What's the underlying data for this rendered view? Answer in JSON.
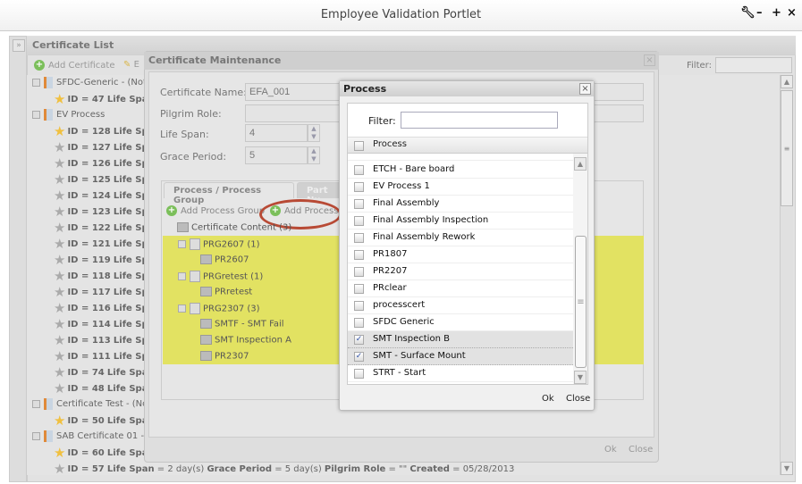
{
  "window": {
    "title": "Employee Validation Portlet",
    "controls": [
      "wrench-icon",
      "minimize-icon",
      "maximize-icon",
      "close-icon"
    ]
  },
  "cert_list": {
    "title": "Certificate List",
    "add_label": "Add Certificate",
    "edit_label": "E",
    "filter_label": "Filter:",
    "filter_value": "",
    "rows": [
      {
        "type": "cert",
        "text": "SFDC-Generic - (Not S"
      },
      {
        "type": "item",
        "star": "gold",
        "id": "ID = 47",
        "rest": "Life Span ="
      },
      {
        "type": "cert",
        "text": "EV Process"
      },
      {
        "type": "item",
        "star": "gold",
        "id": "ID = 128",
        "rest": "Life Span"
      },
      {
        "type": "item",
        "star": "grey",
        "id": "ID = 127",
        "rest": "Life Span"
      },
      {
        "type": "item",
        "star": "grey",
        "id": "ID = 126",
        "rest": "Life Span"
      },
      {
        "type": "item",
        "star": "grey",
        "id": "ID = 125",
        "rest": "Life Span"
      },
      {
        "type": "item",
        "star": "grey",
        "id": "ID = 124",
        "rest": "Life Span"
      },
      {
        "type": "item",
        "star": "grey",
        "id": "ID = 123",
        "rest": "Life Span"
      },
      {
        "type": "item",
        "star": "grey",
        "id": "ID = 122",
        "rest": "Life Span"
      },
      {
        "type": "item",
        "star": "grey",
        "id": "ID = 121",
        "rest": "Life Span"
      },
      {
        "type": "item",
        "star": "grey",
        "id": "ID = 119",
        "rest": "Life Span"
      },
      {
        "type": "item",
        "star": "grey",
        "id": "ID = 118",
        "rest": "Life Span"
      },
      {
        "type": "item",
        "star": "grey",
        "id": "ID = 117",
        "rest": "Life Span"
      },
      {
        "type": "item",
        "star": "grey",
        "id": "ID = 116",
        "rest": "Life Span"
      },
      {
        "type": "item",
        "star": "grey",
        "id": "ID = 114",
        "rest": "Life Span"
      },
      {
        "type": "item",
        "star": "grey",
        "id": "ID = 113",
        "rest": "Life Span"
      },
      {
        "type": "item",
        "star": "grey",
        "id": "ID = 111",
        "rest": "Life Span"
      },
      {
        "type": "item",
        "star": "grey",
        "id": "ID = 74",
        "rest": "Life Span"
      },
      {
        "type": "item",
        "star": "grey",
        "id": "ID = 48",
        "rest": "Life Span"
      },
      {
        "type": "cert",
        "text": "Certificate Test - (No"
      },
      {
        "type": "item",
        "star": "gold",
        "id": "ID = 50",
        "rest": "Life Span ="
      },
      {
        "type": "cert",
        "text": "SAB Certificate 01 - (I"
      },
      {
        "type": "item",
        "star": "gold",
        "id": "ID = 60",
        "rest": "Life Span ="
      },
      {
        "type": "item",
        "star": "grey",
        "id": "ID = 57",
        "rest": "Life Span",
        "tail": "= 2 day(s) <b>Grace Period</b> = 5 day(s) <b>Pilgrim Role</b> = \"\" <b>Created</b> = 05/28/2013"
      }
    ]
  },
  "cert_maint": {
    "title": "Certificate Maintenance",
    "name_label": "Certificate Name:",
    "name_value": "EFA_001",
    "role_label": "Pilgrim Role:",
    "role_value": "",
    "life_label": "Life Span:",
    "life_value": "4",
    "grace_label": "Grace Period:",
    "grace_value": "5",
    "tabs": [
      "Process / Process Group",
      "Part Nu"
    ],
    "add_group_label": "Add Process Group",
    "add_process_label": "Add Process",
    "tree": {
      "root": "Certificate Content (3)",
      "groups": [
        {
          "name": "PRG2607 (1)",
          "children": [
            "PR2607"
          ]
        },
        {
          "name": "PRGretest (1)",
          "children": [
            "PRretest"
          ]
        },
        {
          "name": "PRG2307 (3)",
          "children": [
            "SMTF - SMT Fail",
            "SMT Inspection A",
            "PR2307"
          ]
        }
      ]
    },
    "ok_label": "Ok",
    "close_label": "Close"
  },
  "process_dialog": {
    "title": "Process",
    "filter_label": "Filter:",
    "filter_value": "",
    "column": "Process",
    "rows": [
      {
        "label": "ETCH - Bare board",
        "checked": false
      },
      {
        "label": "EV Process 1",
        "checked": false
      },
      {
        "label": "Final Assembly",
        "checked": false
      },
      {
        "label": "Final Assembly Inspection",
        "checked": false
      },
      {
        "label": "Final Assembly Rework",
        "checked": false
      },
      {
        "label": "PR1807",
        "checked": false
      },
      {
        "label": "PR2207",
        "checked": false
      },
      {
        "label": "PRclear",
        "checked": false
      },
      {
        "label": "processcert",
        "checked": false
      },
      {
        "label": "SFDC Generic",
        "checked": false
      },
      {
        "label": "SMT Inspection B",
        "checked": true
      },
      {
        "label": "SMT - Surface Mount",
        "checked": true
      },
      {
        "label": "STRT - Start",
        "checked": false
      }
    ],
    "ok_label": "Ok",
    "close_label": "Close"
  },
  "colors": {
    "highlight": "#e2e262",
    "annotation": "#b84a35",
    "add_icon": "#7bbf5a"
  }
}
